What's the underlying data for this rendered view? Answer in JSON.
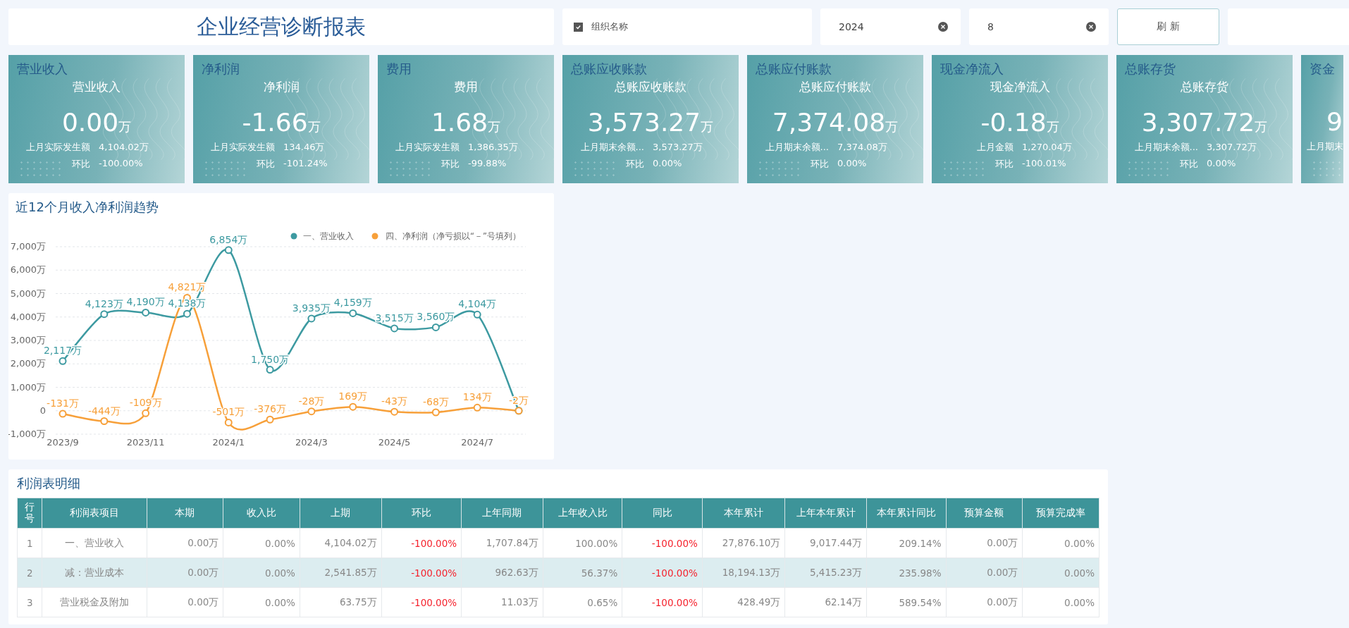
{
  "header": {
    "title": "企业经营诊断报表",
    "org_filter": {
      "label": "组织名称",
      "checked": true
    },
    "year_field": {
      "value": "2024"
    },
    "month_field": {
      "value": "8"
    },
    "refresh_button": "刷 新"
  },
  "kpi_cards": [
    {
      "title": "营业收入",
      "subtitle": "营业收入",
      "value": "0.00",
      "unit": "万",
      "prev_label": "上月实际发生额",
      "prev_value": "4,104.02万",
      "ratio_label": "环比",
      "ratio_value": "-100.00%"
    },
    {
      "title": "净利润",
      "subtitle": "净利润",
      "value": "-1.66",
      "unit": "万",
      "prev_label": "上月实际发生额",
      "prev_value": "134.46万",
      "ratio_label": "环比",
      "ratio_value": "-101.24%"
    },
    {
      "title": "费用",
      "subtitle": "费用",
      "value": "1.68",
      "unit": "万",
      "prev_label": "上月实际发生额",
      "prev_value": "1,386.35万",
      "ratio_label": "环比",
      "ratio_value": "-99.88%"
    },
    {
      "title": "总账应收账款",
      "subtitle": "总账应收账款",
      "value": "3,573.27",
      "unit": "万",
      "prev_label": "上月期末余额...",
      "prev_value": "3,573.27万",
      "ratio_label": "环比",
      "ratio_value": "0.00%"
    },
    {
      "title": "总账应付账款",
      "subtitle": "总账应付账款",
      "value": "7,374.08",
      "unit": "万",
      "prev_label": "上月期末余额...",
      "prev_value": "7,374.08万",
      "ratio_label": "环比",
      "ratio_value": "0.00%"
    },
    {
      "title": "现金净流入",
      "subtitle": "现金净流入",
      "value": "-0.18",
      "unit": "万",
      "prev_label": "上月金额",
      "prev_value": "1,270.04万",
      "ratio_label": "环比",
      "ratio_value": "-100.01%"
    },
    {
      "title": "总账存货",
      "subtitle": "总账存货",
      "value": "3,307.72",
      "unit": "万",
      "prev_label": "上月期末余额...",
      "prev_value": "3,307.72万",
      "ratio_label": "环比",
      "ratio_value": "0.00%"
    },
    {
      "title": "资金",
      "value": "9",
      "prev_label": "上月期末"
    }
  ],
  "trend_panel": {
    "title": "近12个月收入净利润趋势",
    "chart_data": {
      "type": "line",
      "categories": [
        "2023/9",
        null,
        "2023/11",
        null,
        "2024/1",
        null,
        "2024/3",
        null,
        "2024/5",
        null,
        "2024/7",
        null
      ],
      "grid": true,
      "legend": true,
      "ylim": [
        -1000,
        7000
      ],
      "yticks": [
        {
          "value": -1000,
          "label": "-1,000万"
        },
        {
          "value": 0,
          "label": "0"
        },
        {
          "value": 1000,
          "label": "1,000万"
        },
        {
          "value": 2000,
          "label": "2,000万"
        },
        {
          "value": 3000,
          "label": "3,000万"
        },
        {
          "value": 4000,
          "label": "4,000万"
        },
        {
          "value": 5000,
          "label": "5,000万"
        },
        {
          "value": 6000,
          "label": "6,000万"
        },
        {
          "value": 7000,
          "label": "7,000万"
        }
      ],
      "data_labels": true,
      "series": [
        {
          "name": "一、营业收入",
          "color": "#3d9aa1",
          "marker": "circle",
          "values": [
            2117,
            4123,
            4190,
            4138,
            6854,
            1750,
            3935,
            4159,
            3515,
            3560,
            4104,
            0
          ],
          "value_labels": [
            "2,117万",
            "4,123万",
            "4,190万",
            "4,138万",
            "6,854万",
            "1,750万",
            "3,935万",
            "4,159万",
            "3,515万",
            "3,560万",
            "4,104万",
            null
          ]
        },
        {
          "name": "四、净利润（净亏损以“－”号填列）",
          "color": "#f7a03a",
          "marker": "circle",
          "values": [
            -131,
            -444,
            -109,
            4821,
            -501,
            -376,
            -28,
            169,
            -43,
            -68,
            134,
            -2
          ],
          "value_labels": [
            "-131万",
            "-444万",
            "-109万",
            "4,821万",
            "-501万",
            "-376万",
            "-28万",
            "169万",
            "-43万",
            "-68万",
            "134万",
            "-2万"
          ]
        }
      ]
    }
  },
  "profit_table": {
    "title": "利润表明细",
    "columns": [
      {
        "label": "行号",
        "kind": "index"
      },
      {
        "label": "利润表项目",
        "kind": "text"
      },
      {
        "label": "本期",
        "kind": "number"
      },
      {
        "label": "收入比",
        "kind": "number"
      },
      {
        "label": "上期",
        "kind": "number"
      },
      {
        "label": "环比",
        "kind": "change"
      },
      {
        "label": "上年同期",
        "kind": "number"
      },
      {
        "label": "上年收入比",
        "kind": "number"
      },
      {
        "label": "同比",
        "kind": "change"
      },
      {
        "label": "本年累计",
        "kind": "number"
      },
      {
        "label": "上年本年累计",
        "kind": "number"
      },
      {
        "label": "本年累计同比",
        "kind": "number"
      },
      {
        "label": "预算金额",
        "kind": "number"
      },
      {
        "label": "预算完成率",
        "kind": "number"
      }
    ],
    "rows": [
      {
        "declining": true,
        "cells": [
          "1",
          "一、营业收入",
          "0.00万",
          "0.00%",
          "4,104.02万",
          "-100.00%",
          "1,707.84万",
          "100.00%",
          "-100.00%",
          "27,876.10万",
          "9,017.44万",
          "209.14%",
          "0.00万",
          "0.00%"
        ]
      },
      {
        "declining": true,
        "cells": [
          "2",
          "减：营业成本",
          "0.00万",
          "0.00%",
          "2,541.85万",
          "-100.00%",
          "962.63万",
          "56.37%",
          "-100.00%",
          "18,194.13万",
          "5,415.23万",
          "235.98%",
          "0.00万",
          "0.00%"
        ]
      },
      {
        "declining": true,
        "cells": [
          "3",
          "营业税金及附加",
          "0.00万",
          "0.00%",
          "63.75万",
          "-100.00%",
          "11.03万",
          "0.65%",
          "-100.00%",
          "428.49万",
          "62.14万",
          "589.54%",
          "0.00万",
          "0.00%"
        ]
      }
    ]
  }
}
